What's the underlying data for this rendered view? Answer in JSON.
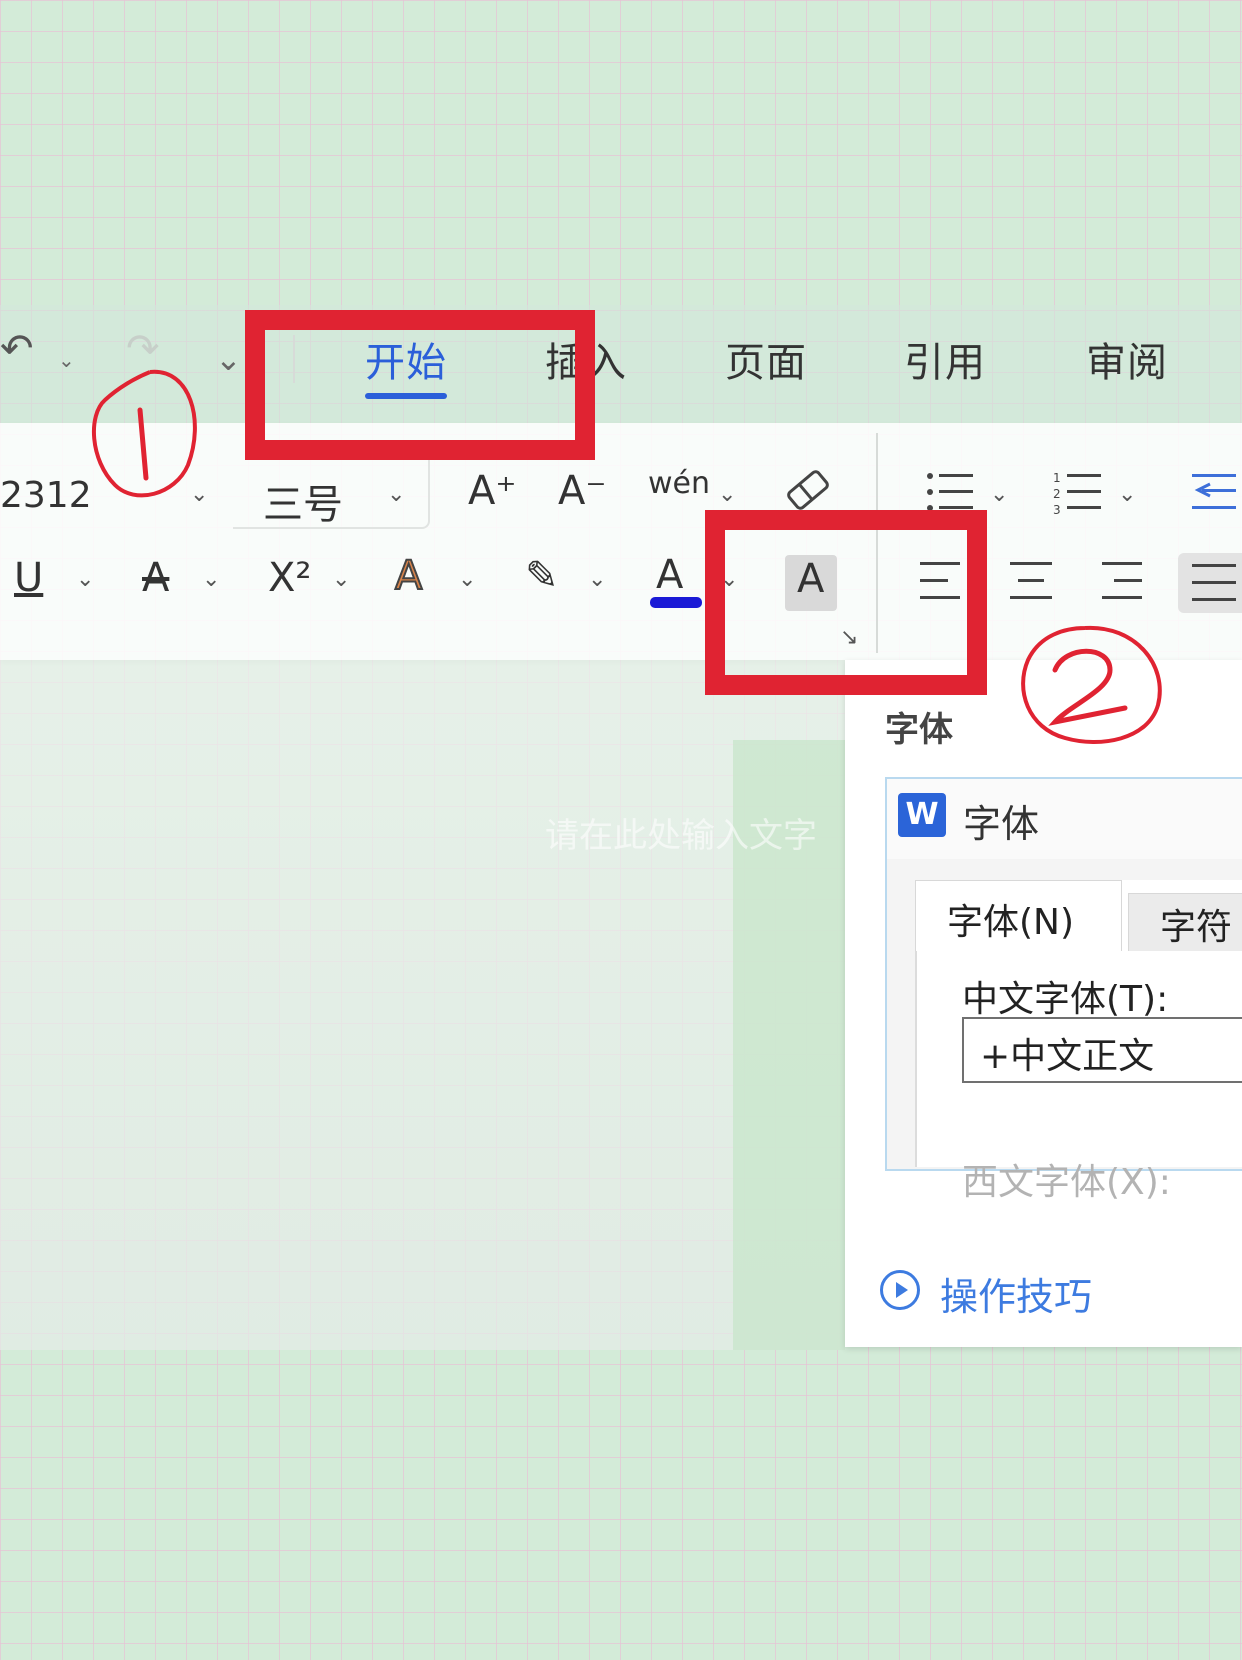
{
  "quick_access": {
    "undo_icon": "undo-icon",
    "redo_icon": "redo-icon",
    "customize_icon": "chevron-down-icon"
  },
  "tabs": [
    {
      "label": "开始",
      "active": true
    },
    {
      "label": "插入",
      "active": false
    },
    {
      "label": "页面",
      "active": false
    },
    {
      "label": "引用",
      "active": false
    },
    {
      "label": "审阅",
      "active": false
    }
  ],
  "ribbon": {
    "font_name_value": "2312",
    "font_size_value": "三号",
    "grow_font": "A⁺",
    "shrink_font": "A⁻",
    "phonetic_guide": "wén",
    "bold_like_underline": "U",
    "strikethrough": "A",
    "superscript": "X²",
    "text_effect": "A",
    "highlight": "✎",
    "font_color": "A",
    "character_shading": "A",
    "launcher": "↘",
    "font_color_hex": "#1a1ad6"
  },
  "document": {
    "ghost_text": "请在此处输入文字"
  },
  "tooltip": {
    "title": "字体",
    "preview_app_icon": "W",
    "preview_title": "字体",
    "tab_font": "字体(N)",
    "tab_char": "字符",
    "cn_font_label": "中文字体(T):",
    "cn_font_value": "+中文正文",
    "west_font_label": "西文字体(X):",
    "tips_link": "操作技巧"
  },
  "annotations": {
    "step1": "1",
    "step2": "2",
    "color": "#e02332"
  }
}
